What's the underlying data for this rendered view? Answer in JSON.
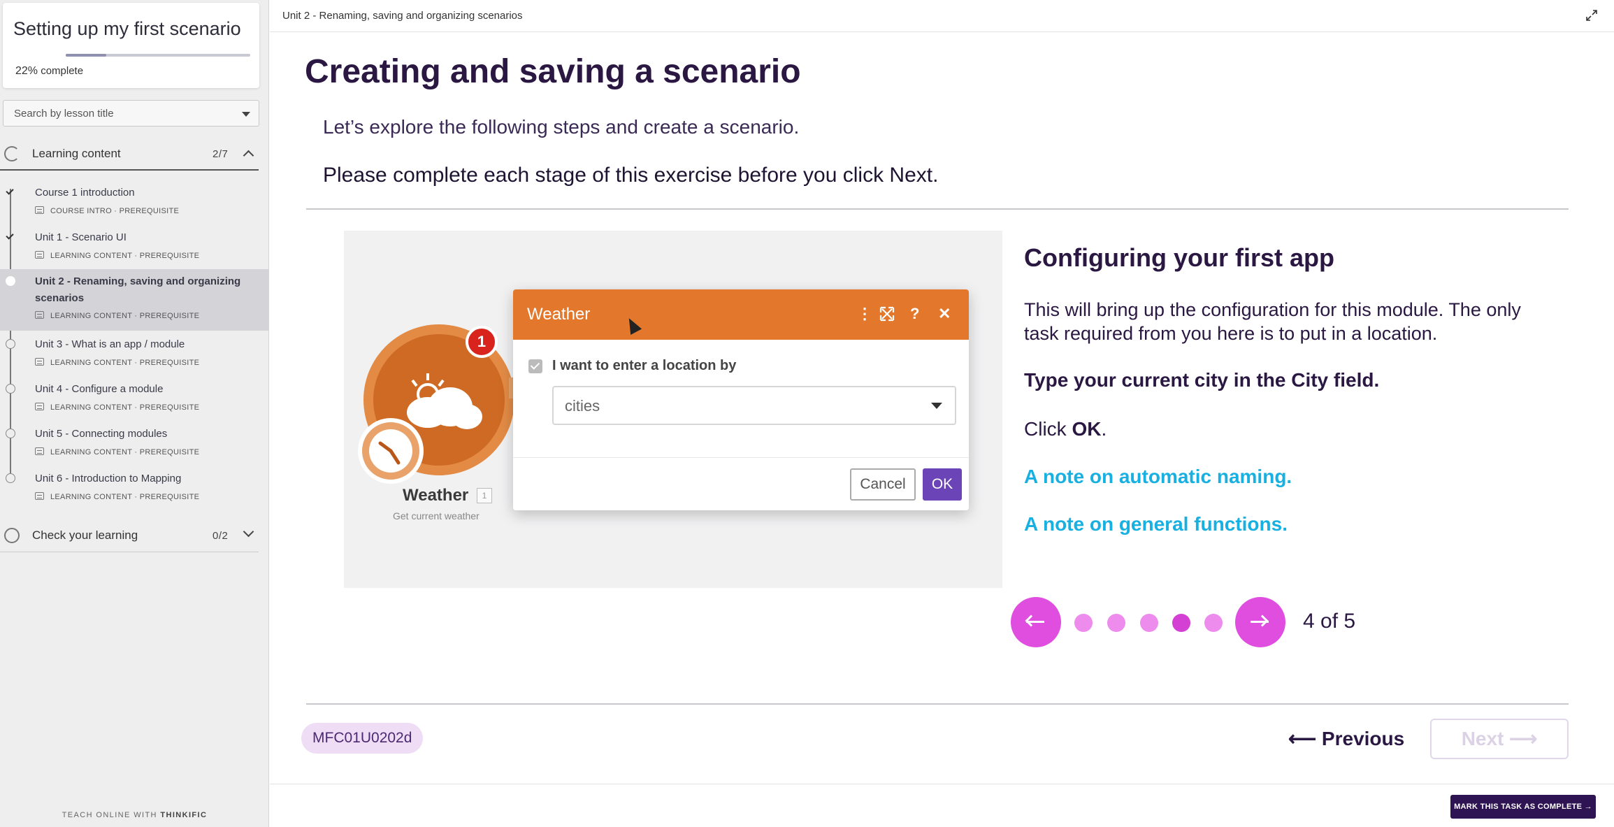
{
  "sidebar": {
    "course_title": "Setting up my first scenario",
    "progress_percent": 22,
    "progress_value": "22%",
    "progress_suffix": "complete",
    "search_placeholder": "Search by lesson title",
    "sections": [
      {
        "label": "Learning content",
        "count": "2/7",
        "expanded": true,
        "lessons": [
          {
            "title": "Course 1 introduction",
            "meta": "COURSE INTRO · PREREQUISITE",
            "status": "done"
          },
          {
            "title": "Unit 1 - Scenario UI",
            "meta": "LEARNING CONTENT · PREREQUISITE",
            "status": "done"
          },
          {
            "title": "Unit 2 - Renaming, saving and organizing scenarios",
            "meta": "LEARNING CONTENT · PREREQUISITE",
            "status": "current"
          },
          {
            "title": "Unit 3 - What is an app / module",
            "meta": "LEARNING CONTENT · PREREQUISITE",
            "status": "todo"
          },
          {
            "title": "Unit 4 - Configure a module",
            "meta": "LEARNING CONTENT · PREREQUISITE",
            "status": "todo"
          },
          {
            "title": "Unit 5 - Connecting modules",
            "meta": "LEARNING CONTENT · PREREQUISITE",
            "status": "todo"
          },
          {
            "title": "Unit 6 - Introduction to Mapping",
            "meta": "LEARNING CONTENT · PREREQUISITE",
            "status": "todo"
          }
        ]
      },
      {
        "label": "Check your learning",
        "count": "0/2",
        "expanded": false
      }
    ],
    "footer_prefix": "TEACH ONLINE WITH",
    "footer_brand": "THINKIFIC"
  },
  "topbar": {
    "title": "Unit 2 - Renaming, saving and organizing scenarios"
  },
  "main": {
    "page_title": "Creating and saving a scenario",
    "intro_line_1": "Let’s explore the following steps and create a scenario.",
    "intro_line_2": "Please complete each stage of this exercise before you click Next."
  },
  "slide": {
    "image": {
      "dialog_title": "Weather",
      "badge": "1",
      "checkbox_label": "I want to enter a location by",
      "select_value": "cities",
      "cancel_label": "Cancel",
      "ok_label": "OK",
      "module_name": "Weather",
      "module_number": "1",
      "module_subtitle": "Get current weather"
    },
    "heading": "Configuring your first app",
    "paragraph": "This will bring up the configuration for this module. The only task required from you here is to put in a location.",
    "instruction": "Type your current city in the City field.",
    "click_prefix": "Click",
    "click_target": "OK",
    "click_suffix": ".",
    "notes": [
      "A note on automatic naming.",
      "A note on general functions."
    ],
    "carousel": {
      "current": 4,
      "total": 5,
      "counter_text": "4 of 5"
    }
  },
  "footer": {
    "lesson_code": "MFC01U0202d",
    "previous_label": "Previous",
    "next_label": "Next",
    "mark_complete_label": "MARK THIS TASK AS COMPLETE"
  },
  "colors": {
    "brand_dark": "#2a1842",
    "carousel_accent": "#e04ee0",
    "note_link": "#17b0e0",
    "weather_orange": "#e3782c",
    "ok_purple": "#6b45b8"
  }
}
